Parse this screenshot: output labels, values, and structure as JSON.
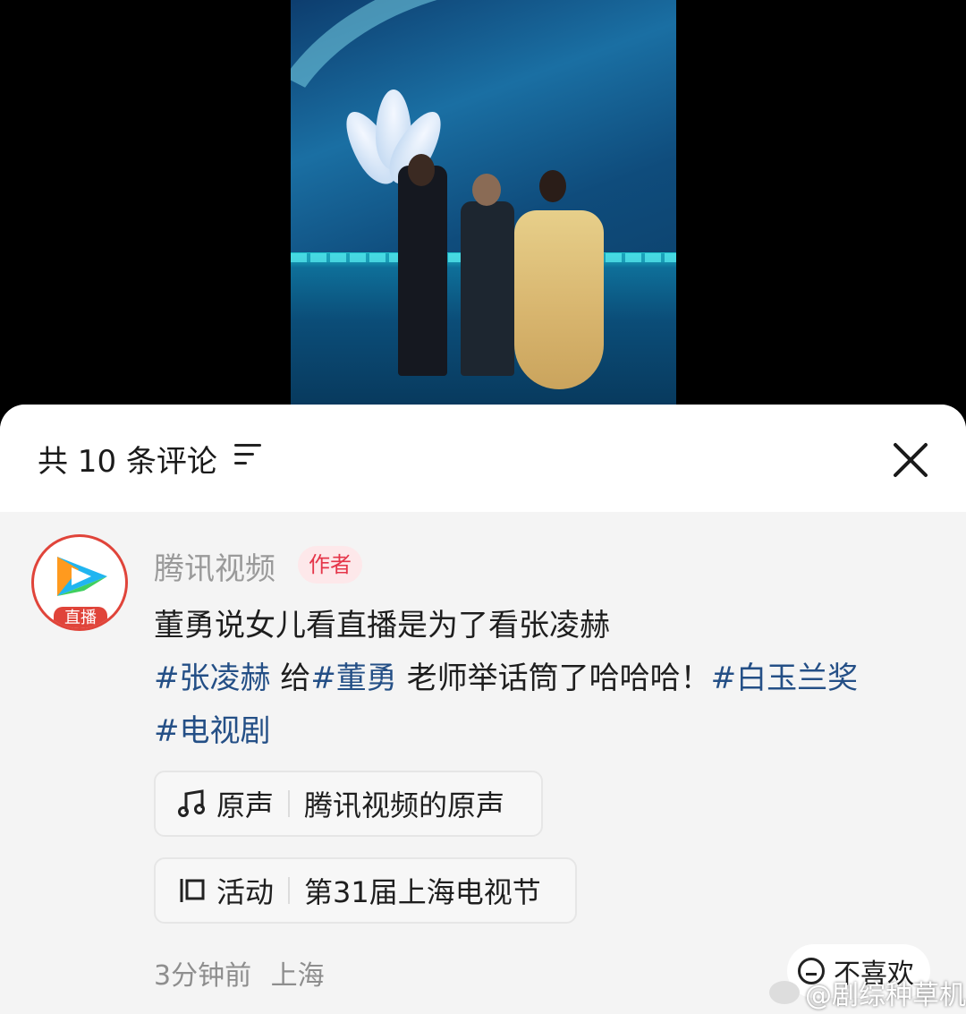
{
  "sheet": {
    "comment_count": "共 10 条评论"
  },
  "comment": {
    "avatar_badge": "直播",
    "author_name": "腾讯视频",
    "author_tag": "作者",
    "text_line1": "董勇说女儿看直播是为了看张凌赫",
    "hashtag1": "#张凌赫",
    "text_mid1": " 给",
    "hashtag2": "#董勇",
    "text_mid2": " 老师举话筒了哈哈哈！",
    "hashtag3": "#白玉兰奖",
    "hashtag4": "#电视剧",
    "audio_label": "原声",
    "audio_value": "腾讯视频的原声",
    "event_label": "活动",
    "event_value": "第31届上海电视节",
    "time": "3分钟前",
    "location": "上海",
    "dislike_label": "不喜欢"
  },
  "watermark": {
    "text": "@剧综种草机"
  },
  "colors": {
    "accent_red": "#e0443a",
    "hashtag_blue": "#244f86",
    "tag_bg": "#fde8ea"
  }
}
